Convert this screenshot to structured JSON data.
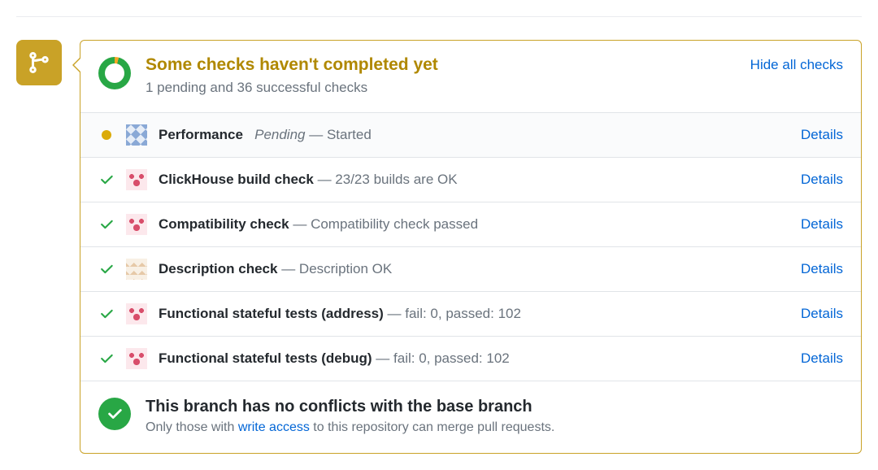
{
  "header": {
    "title": "Some checks haven't completed yet",
    "subtitle": "1 pending and 36 successful checks",
    "hide_link": "Hide all checks"
  },
  "checks": [
    {
      "status": "pending",
      "avatar": "blue",
      "name": "Performance",
      "status_text": "Pending",
      "description": "— Started",
      "italic_status": true,
      "details": "Details"
    },
    {
      "status": "success",
      "avatar": "pink",
      "name": "ClickHouse build check",
      "status_text": "",
      "description": "— 23/23 builds are OK",
      "italic_status": false,
      "details": "Details"
    },
    {
      "status": "success",
      "avatar": "pink",
      "name": "Compatibility check",
      "status_text": "",
      "description": "— Compatibility check passed",
      "italic_status": false,
      "details": "Details"
    },
    {
      "status": "success",
      "avatar": "tan",
      "name": "Description check",
      "status_text": "",
      "description": "— Description OK",
      "italic_status": false,
      "details": "Details"
    },
    {
      "status": "success",
      "avatar": "pink",
      "name": "Functional stateful tests (address)",
      "status_text": "",
      "description": "— fail: 0, passed: 102",
      "italic_status": false,
      "details": "Details"
    },
    {
      "status": "success",
      "avatar": "pink",
      "name": "Functional stateful tests (debug)",
      "status_text": "",
      "description": "— fail: 0, passed: 102",
      "italic_status": false,
      "details": "Details"
    }
  ],
  "footer": {
    "title": "This branch has no conflicts with the base branch",
    "sub_pre": "Only those with ",
    "sub_link": "write access",
    "sub_post": " to this repository can merge pull requests."
  },
  "colors": {
    "accent_warn": "#b08800",
    "border_warn": "#c9a227",
    "success": "#28a745",
    "link": "#0366d6",
    "pending_dot": "#dbab09"
  }
}
